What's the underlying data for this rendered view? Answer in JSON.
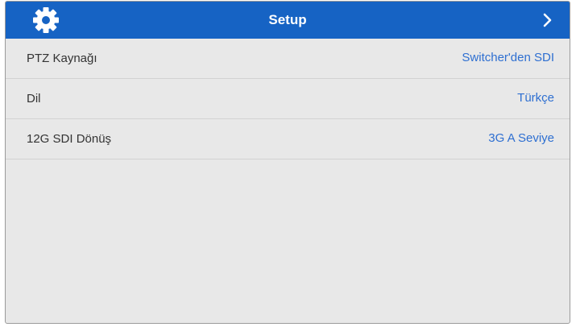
{
  "header": {
    "title": "Setup",
    "left_icon": "gear-icon",
    "right_icon": "chevron-right-icon",
    "background_color": "#1663c4"
  },
  "settings": [
    {
      "label": "PTZ Kaynağı",
      "value": "Switcher'den SDI"
    },
    {
      "label": "Dil",
      "value": "Türkçe"
    },
    {
      "label": "12G SDI Dönüş",
      "value": "3G A Seviye"
    }
  ],
  "colors": {
    "accent_value": "#2e6fd1",
    "panel_background": "#e8e8e8"
  }
}
